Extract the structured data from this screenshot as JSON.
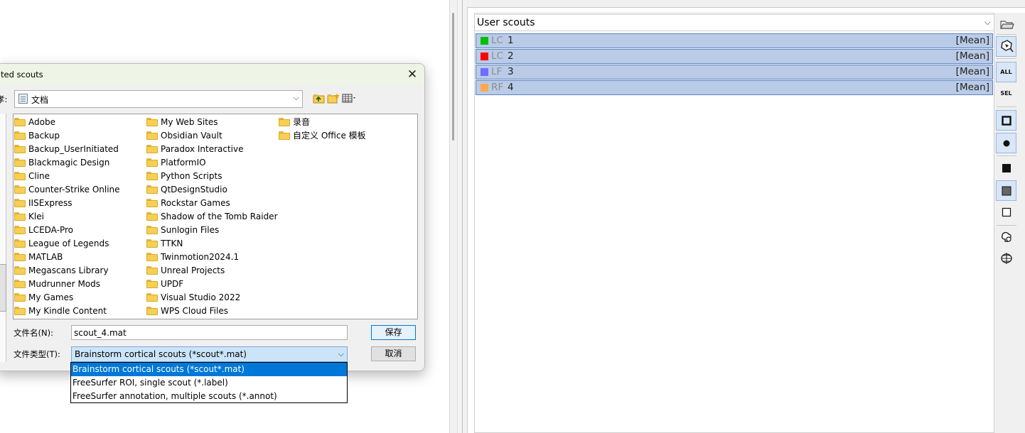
{
  "dialog": {
    "title": "ted scouts",
    "save_in_label": "孝:",
    "current_folder": "文档",
    "folders_col1": [
      "Adobe",
      "Backup",
      "Backup_UserInitiated",
      "Blackmagic Design",
      "Cline",
      "Counter-Strike Online",
      "IISExpress",
      "Klei",
      "LCEDA-Pro",
      "League of Legends",
      "MATLAB",
      "Megascans Library",
      "Mudrunner Mods",
      "My Games",
      "My Kindle Content"
    ],
    "folders_col2": [
      "My Web Sites",
      "Obsidian Vault",
      "Paradox Interactive",
      "PlatformIO",
      "Python Scripts",
      "QtDesignStudio",
      "Rockstar Games",
      "Shadow of the Tomb Raider",
      "Sunlogin Files",
      "TTKN",
      "Twinmotion2024.1",
      "Unreal Projects",
      "UPDF",
      "Visual Studio 2022",
      "WPS Cloud Files"
    ],
    "folders_col3": [
      "录音",
      "自定义 Office 模板"
    ],
    "filename_label": "文件名(N):",
    "filename_value": "scout_4.mat",
    "filetype_label": "文件类型(T):",
    "filetype_value": "Brainstorm cortical scouts (*scout*.mat)",
    "save_button": "保存",
    "cancel_button": "取消",
    "filetype_options": [
      "Brainstorm cortical scouts (*scout*.mat)",
      "FreeSurfer ROI, single scout (*.label)",
      "FreeSurfer annotation, multiple scouts (*.annot)"
    ],
    "selected_option_index": 0
  },
  "scouts_panel": {
    "atlas_selector": "User scouts",
    "scouts": [
      {
        "region": "LC",
        "label": "1",
        "function": "[Mean]",
        "color": "#00c000"
      },
      {
        "region": "LC",
        "label": "2",
        "function": "[Mean]",
        "color": "#ff0000"
      },
      {
        "region": "LF",
        "label": "3",
        "function": "[Mean]",
        "color": "#6f6fff"
      },
      {
        "region": "RF",
        "label": "4",
        "function": "[Mean]",
        "color": "#ffa850"
      }
    ]
  },
  "toolbar": {
    "all_label": "ALL",
    "sel_label": "SEL"
  }
}
